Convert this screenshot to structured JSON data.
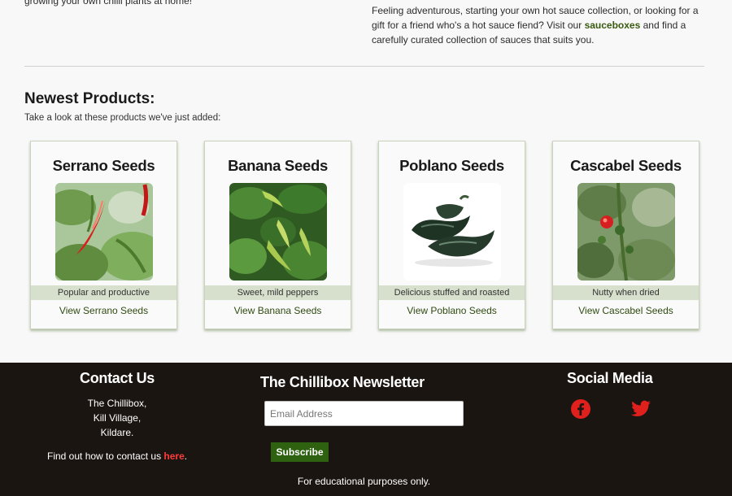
{
  "intro": {
    "left_text": "growing your own chilli plants at home!",
    "right_before": "Feeling adventurous, starting your own hot sauce collection, or looking for a gift for a friend who's a hot sauce fiend? Visit our ",
    "right_link": "sauceboxes",
    "right_after": " and find a carefully curated collection of sauces that suits you."
  },
  "products_section": {
    "title": "Newest Products:",
    "subtitle": "Take a look at these products we've just added:"
  },
  "products": [
    {
      "title": "Serrano Seeds",
      "tag": "Popular and productive",
      "link": "View Serrano Seeds",
      "image": "serrano-chilli-image"
    },
    {
      "title": "Banana Seeds",
      "tag": "Sweet, mild peppers",
      "link": "View Banana Seeds",
      "image": "banana-pepper-image"
    },
    {
      "title": "Poblano Seeds",
      "tag": "Delicious stuffed and roasted",
      "link": "View Poblano Seeds",
      "image": "poblano-pepper-image"
    },
    {
      "title": "Cascabel Seeds",
      "tag": "Nutty when dried",
      "link": "View Cascabel Seeds",
      "image": "cascabel-chilli-image"
    }
  ],
  "footer": {
    "contact": {
      "title": "Contact Us",
      "address": [
        "The Chillibox,",
        "Kill Village,",
        "Kildare."
      ],
      "line_before": "Find out how to contact us ",
      "line_link": "here",
      "line_after": "."
    },
    "newsletter": {
      "title": "The Chillibox Newsletter",
      "email_placeholder": "Email Address",
      "button": "Subscribe"
    },
    "social": {
      "title": "Social Media",
      "icons": [
        "facebook-icon",
        "twitter-icon"
      ],
      "color": "#e0201c"
    },
    "note": "For educational purposes only."
  },
  "colors": {
    "background": "#f8f8f8",
    "footer_bg": "#1b1512",
    "accent_green": "#2e6110",
    "link_red": "#ff3b3b",
    "tag_bg": "#d6e0cc"
  }
}
